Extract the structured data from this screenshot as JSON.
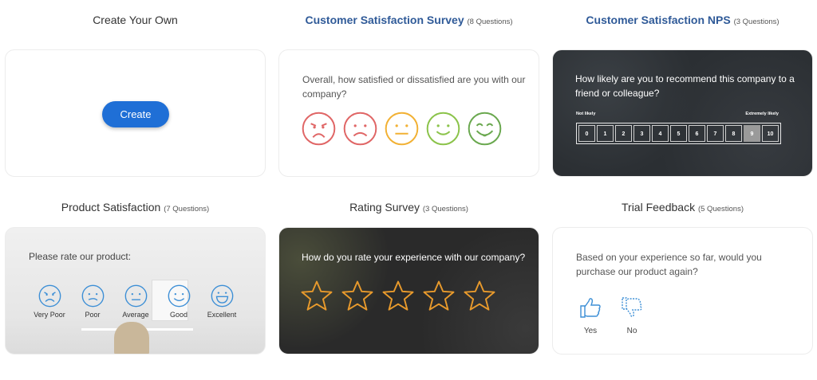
{
  "tiles": {
    "create": {
      "title": "Create Your Own",
      "button": "Create"
    },
    "csat": {
      "title": "Customer Satisfaction Survey",
      "count": "(8 Questions)",
      "question": "Overall, how satisfied or dissatisfied are you with our company?",
      "face_colors": [
        "#e06666",
        "#e06666",
        "#f2b134",
        "#8bc34a",
        "#6aa84f"
      ]
    },
    "nps": {
      "title": "Customer Satisfaction NPS",
      "count": "(3 Questions)",
      "question": "How likely are you to recommend this company to a friend or colleague?",
      "low_label": "Not likely",
      "high_label": "Extremely likely",
      "scale": [
        "0",
        "1",
        "2",
        "3",
        "4",
        "5",
        "6",
        "7",
        "8",
        "9",
        "10"
      ],
      "selected": "9"
    },
    "product": {
      "title": "Product Satisfaction",
      "count": "(7 Questions)",
      "question": "Please rate our product:",
      "options": [
        "Very Poor",
        "Poor",
        "Average",
        "Good",
        "Excellent"
      ],
      "icon_color": "#3d8fd6"
    },
    "rating": {
      "title": "Rating Survey",
      "count": "(3 Questions)",
      "question": "How do you rate your experience with our company?",
      "star_count": 5,
      "star_color": "#e89a2c"
    },
    "trial": {
      "title": "Trial Feedback",
      "count": "(5 Questions)",
      "question": "Based on your experience so far, would you purchase our product again?",
      "yes": "Yes",
      "no": "No",
      "icon_color": "#3d8fd6"
    }
  }
}
